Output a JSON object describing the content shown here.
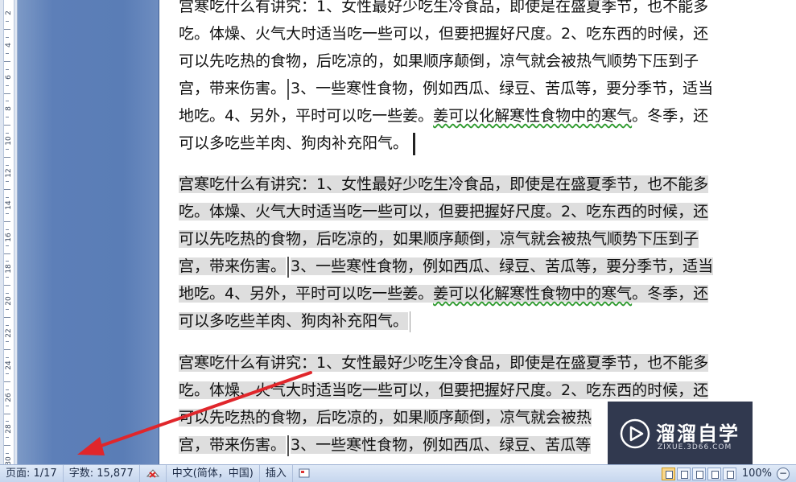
{
  "document": {
    "paragraphs": [
      {
        "highlighted": false,
        "lines": [
          "宫寒吃什么有讲究：1、女性最好少吃生冷食品，即使是在盛夏季节，也不能多",
          "吃。体燥、火气大时适当吃一些可以，但要把握好尺度。2、吃东西的时候，还",
          "可以先吃热的食物，后吃凉的，如果顺序颠倒，凉气就会被热气顺势下压到子",
          "宫，带来伤害。",
          "地吃。4、另外，平时可以吃一些姜。",
          "可以多吃些羊肉、狗肉补充阳气。"
        ],
        "line4_rest": "3、一些寒性食物，例如西瓜、绿豆、苦瓜等，要分季节，适当",
        "line5_wavy": "姜可以化解寒性食物中的寒气",
        "line5_rest": "。冬季，还"
      },
      {
        "highlighted": true,
        "lines": [
          "宫寒吃什么有讲究：1、女性最好少吃生冷食品，即使是在盛夏季节，也不能多",
          "吃。体燥、火气大时适当吃一些可以，但要把握好尺度。2、吃东西的时候，还",
          "可以先吃热的食物，后吃凉的，如果顺序颠倒，凉气就会被热气顺势下压到子",
          "宫，带来伤害。",
          "地吃。4、另外，平时可以吃一些姜。",
          "可以多吃些羊肉、狗肉补充阳气。"
        ],
        "line4_rest": "3、一些寒性食物，例如西瓜、绿豆、苦瓜等，要分季节，适当",
        "line5_wavy": "姜可以化解寒性食物中的寒气",
        "line5_rest": "。冬季，还"
      },
      {
        "highlighted": true,
        "lines": [
          "宫寒吃什么有讲究：1、女性最好少吃生冷食品，即使是在盛夏季节，也不能多",
          "吃。体燥、火气大时适当吃一些可以，但要把握好尺度。2、吃东西的时候，还",
          "可以先吃热的食物，后吃凉的，如果顺序颠倒，凉气就会被热",
          "宫，带来伤害。"
        ],
        "line4_rest": "3、一些寒性食物，例如西瓜、绿豆、苦瓜等"
      }
    ]
  },
  "ruler": {
    "numbers": [
      "2",
      "4",
      "6",
      "8",
      "10",
      "12",
      "14",
      "16",
      "18",
      "20",
      "22",
      "24",
      "26",
      "28",
      "30"
    ]
  },
  "watermark": {
    "brand": "溜溜自学",
    "site": "ZIXUE.3D66.COM"
  },
  "statusbar": {
    "page": "页面: 1/17",
    "wordcount": "字数: 15,877",
    "language": "中文(简体，中国)",
    "mode": "插入",
    "zoom": "100%",
    "zoom_out": "−"
  },
  "colors": {
    "gutter": "#5a7db6",
    "highlight": "#dedede",
    "arrow": "#e0262b",
    "statusbar": "#c6d6ee"
  }
}
